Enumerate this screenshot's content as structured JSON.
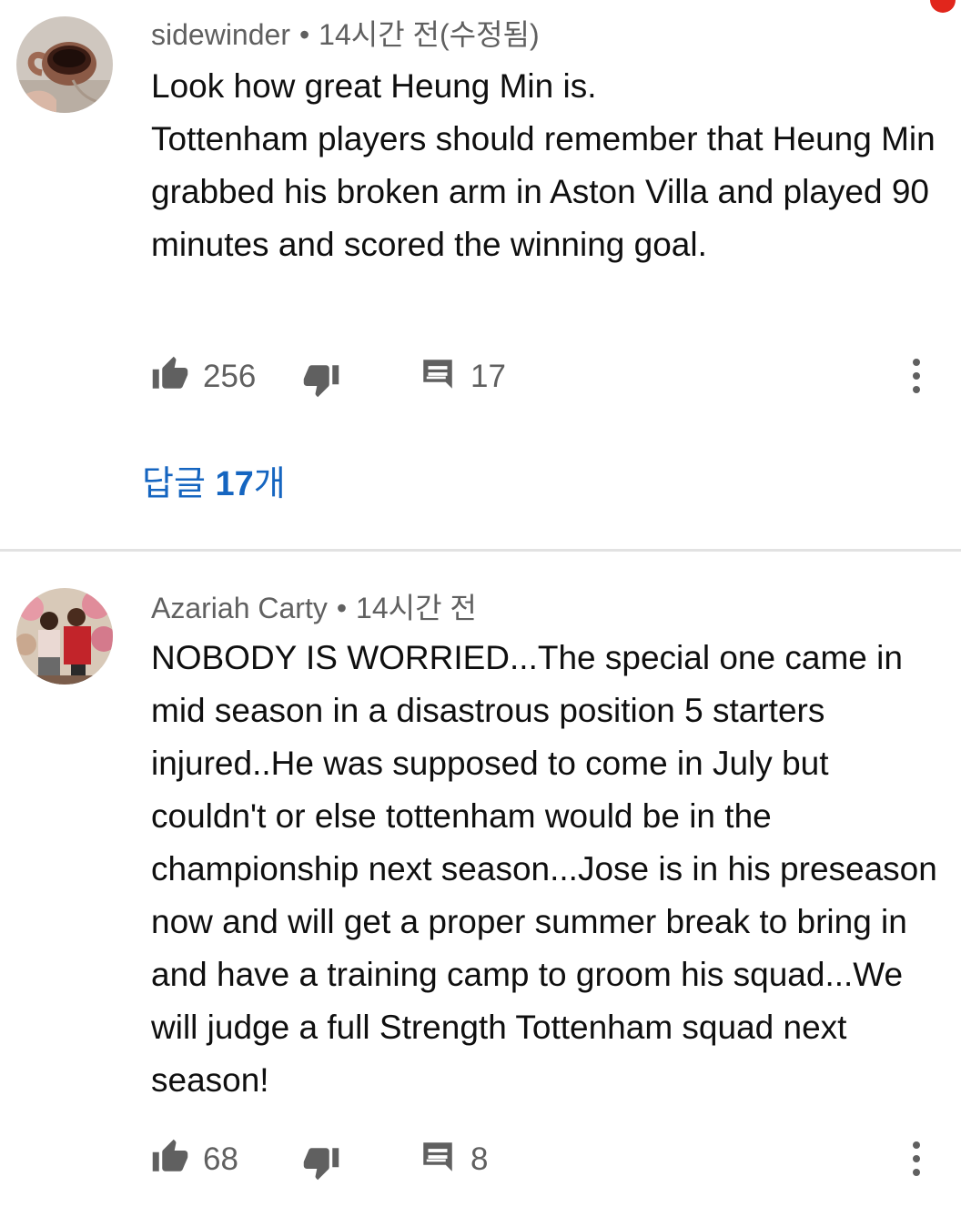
{
  "comments": [
    {
      "author": "sidewinder",
      "separator": "•",
      "timestamp": "14시간 전(수정됨)",
      "text": "Look how great Heung Min is.\nTottenham players should remember that Heung Min grabbed his broken arm in Aston Villa and played 90 minutes and scored the winning goal.",
      "likes": "256",
      "replies": "17",
      "replies_link_prefix": "답글 ",
      "replies_link_count": "17",
      "replies_link_suffix": "개",
      "avatar_icon": "mug-photo-avatar",
      "more_icon": "more-vertical-icon"
    },
    {
      "author": "Azariah Carty",
      "separator": "•",
      "timestamp": "14시간 전",
      "text": "NOBODY IS WORRIED...The special one came in mid season in a disastrous position  5 starters injured..He was supposed to come in July but couldn't or else tottenham would be in the championship next season...Jose is in his preseason now and will get a proper summer break to bring in and have a training camp to groom his squad...We will judge a full Strength Tottenham squad next season!",
      "likes": "68",
      "replies": "8",
      "avatar_icon": "people-photo-avatar",
      "more_icon": "more-vertical-icon"
    }
  ],
  "colors": {
    "link": "#1565c0",
    "secondary_text": "#606060",
    "primary_text": "#0f0f0f",
    "icon": "#606060",
    "notification_dot": "#e1261c"
  }
}
